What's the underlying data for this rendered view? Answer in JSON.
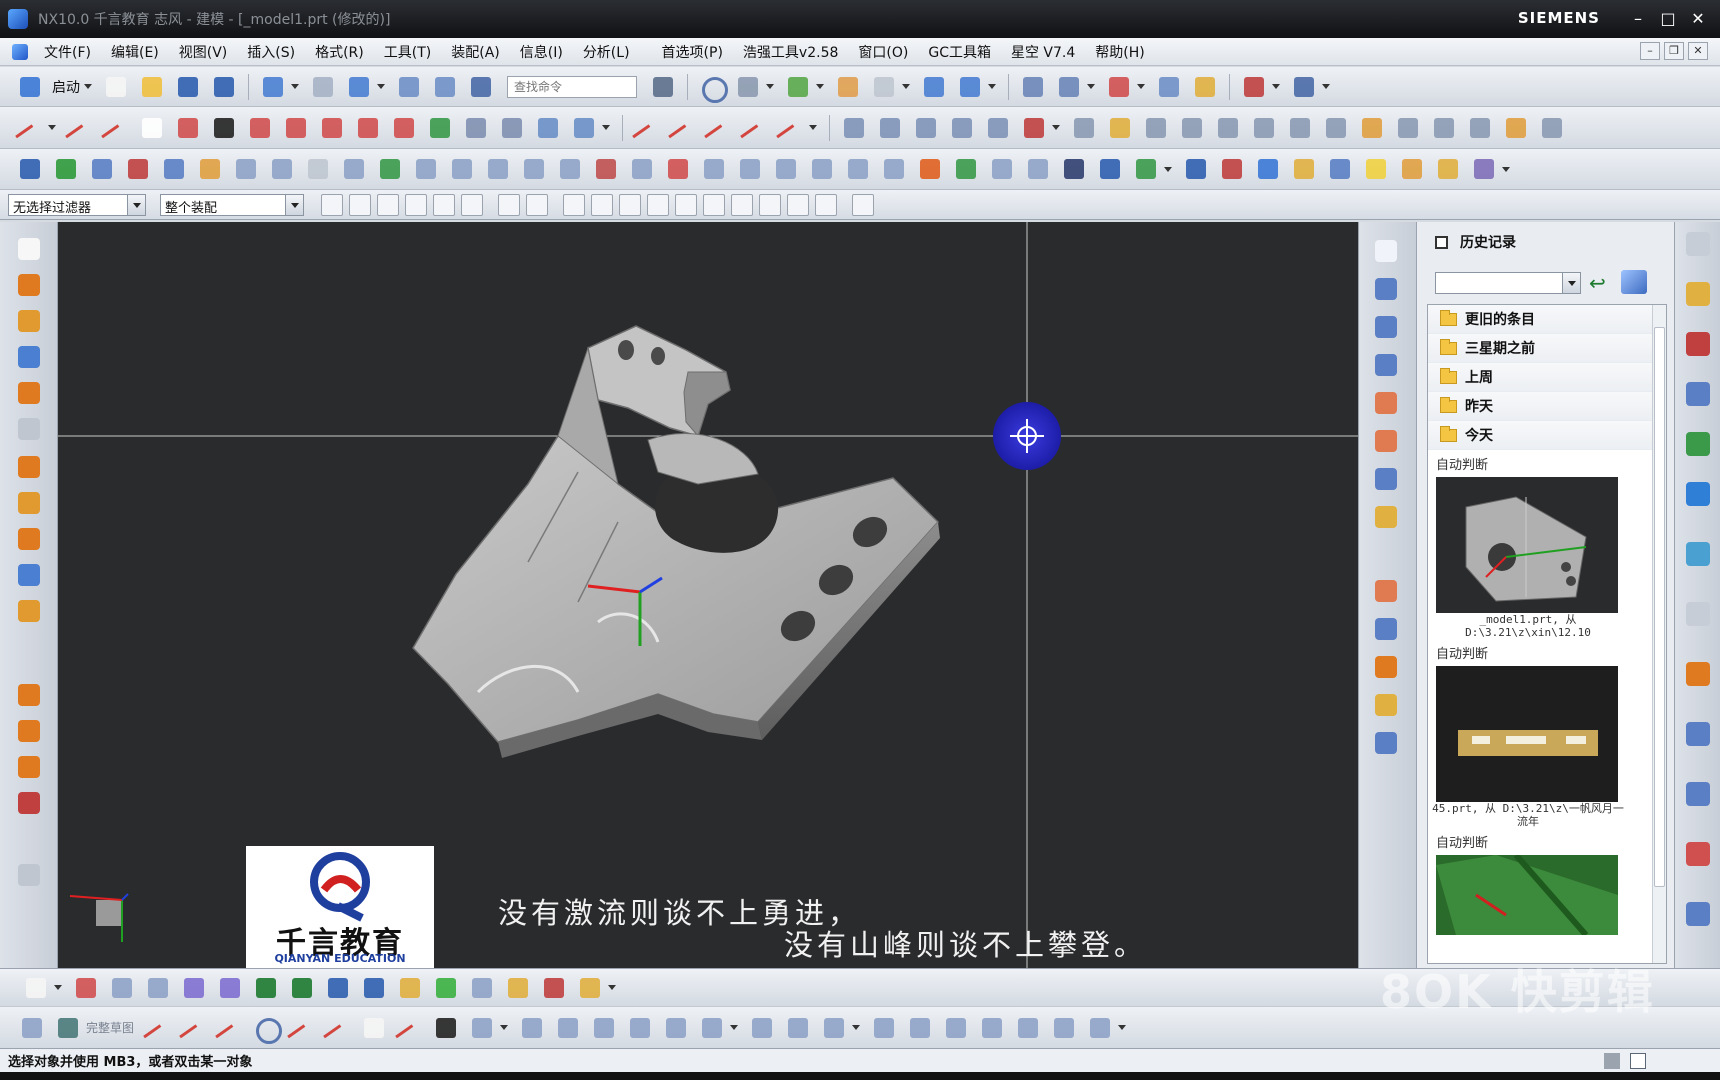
{
  "titlebar": {
    "title": "NX10.0 千言教育 志风 - 建模 - [_model1.prt (修改的)]",
    "brand": "SIEMENS"
  },
  "menu": {
    "items": [
      "文件(F)",
      "编辑(E)",
      "视图(V)",
      "插入(S)",
      "格式(R)",
      "工具(T)",
      "装配(A)",
      "信息(I)",
      "分析(L)",
      "首选项(P)",
      "浩强工具v2.58",
      "窗口(O)",
      "GC工具箱",
      "星空 V7.4",
      "帮助(H)"
    ]
  },
  "toolbar": {
    "start_label": "启动",
    "search_placeholder": "查找命令"
  },
  "selection_bar": {
    "filter_value": "无选择过滤器",
    "scope_value": "整个装配"
  },
  "history_panel": {
    "title": "历史记录",
    "folders": [
      "更旧的条目",
      "三星期之前",
      "上周",
      "昨天",
      "今天"
    ],
    "entries": [
      {
        "section": "自动判断",
        "caption": "_model1.prt, 从 D:\\3.21\\z\\xin\\12.10"
      },
      {
        "section": "自动判断",
        "caption": "45.prt, 从 D:\\3.21\\z\\一帆风月一流年"
      },
      {
        "section": "自动判断",
        "caption": ""
      }
    ]
  },
  "subtitle": {
    "line1": "没有激流则谈不上勇进，",
    "line2": "没有山峰则谈不上攀登。"
  },
  "logo": {
    "name": "千言教育",
    "english": "QIANYAN EDUCATION"
  },
  "bottom_toolbar": {
    "disabled_label": "完整草图"
  },
  "status": {
    "message": "选择对象并使用 MB3，或者双击某一对象"
  },
  "watermark": {
    "text": "8OK 快剪辑"
  },
  "colors": {
    "viewport_bg": "#2a2b2d",
    "part_gray": "#b7b7b7",
    "csys_blue": "#2f2fcf",
    "title_bg": "#1c1e22"
  }
}
